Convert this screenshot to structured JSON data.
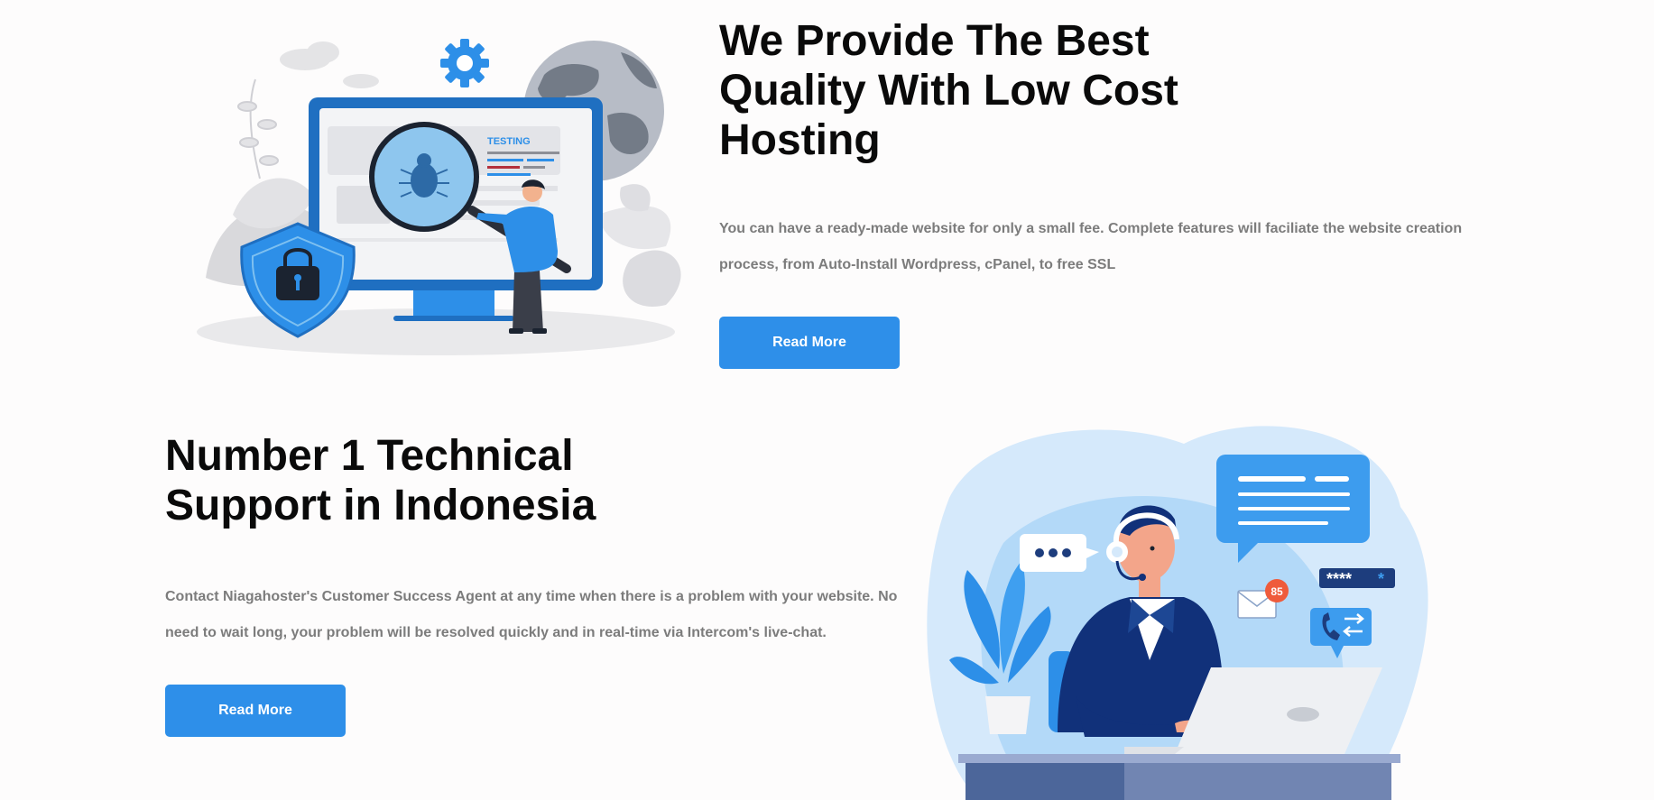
{
  "section_hosting": {
    "title": "We Provide The Best Quality With Low Cost Hosting",
    "description": "You can have a ready-made website for only a small fee. Complete features will faciliate the website creation process, from Auto-Install Wordpress, cPanel, to free SSL",
    "button_label": "Read More",
    "illustration": {
      "label": "TESTING",
      "icons": [
        "gear-icon",
        "globe-icon",
        "shield-lock-icon",
        "bug-icon",
        "magnifier-icon"
      ]
    }
  },
  "section_support": {
    "title": "Number 1 Technical Support in Indonesia",
    "description": "Contact Niagahoster's Customer Success Agent at any time when there is a problem with your website. No need to wait long, your problem will be resolved quickly and in real-time via Intercom's live-chat.",
    "button_label": "Read More",
    "illustration": {
      "mail_badge": "85",
      "password_mask": "****",
      "password_mask_accent": "*",
      "icons": [
        "chat-bubble-icon",
        "mail-icon",
        "phone-transfer-icon",
        "headset-icon",
        "laptop-icon",
        "plant-icon"
      ]
    }
  },
  "colors": {
    "accent": "#2e8fe9",
    "title": "#0a0a0a",
    "body_text": "#7c7c7c",
    "background": "#fdfcfc"
  }
}
